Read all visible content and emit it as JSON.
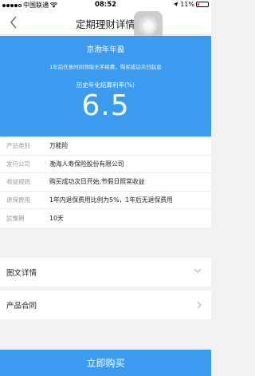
{
  "status_bar": {
    "carrier": "中国联通",
    "time": "08:52",
    "battery": "11%"
  },
  "nav": {
    "title": "定期理财详情"
  },
  "hero": {
    "product_name": "京渤年年盈",
    "note": "1年后任意时间领取无手续费，购买成功次日起息",
    "rate_label": "历史年化结算利率(%)",
    "rate_value": "6.5"
  },
  "info": {
    "rows": [
      {
        "label": "产品类别",
        "value": "万能险"
      },
      {
        "label": "发行公司",
        "value": "渤海人寿保险股份有限公司"
      },
      {
        "label": "收益规则",
        "value": "购买成功次日开始,节假日照常收益"
      },
      {
        "label": "退保费用",
        "value": "1年内退保费用比例为5%，1年后无退保费用"
      },
      {
        "label": "犹豫期",
        "value": "10天"
      }
    ]
  },
  "links": {
    "details": "图文详情",
    "contract": "产品合同"
  },
  "actions": {
    "buy_label": "立即购买"
  },
  "colors": {
    "accent": "#3c9bef"
  }
}
